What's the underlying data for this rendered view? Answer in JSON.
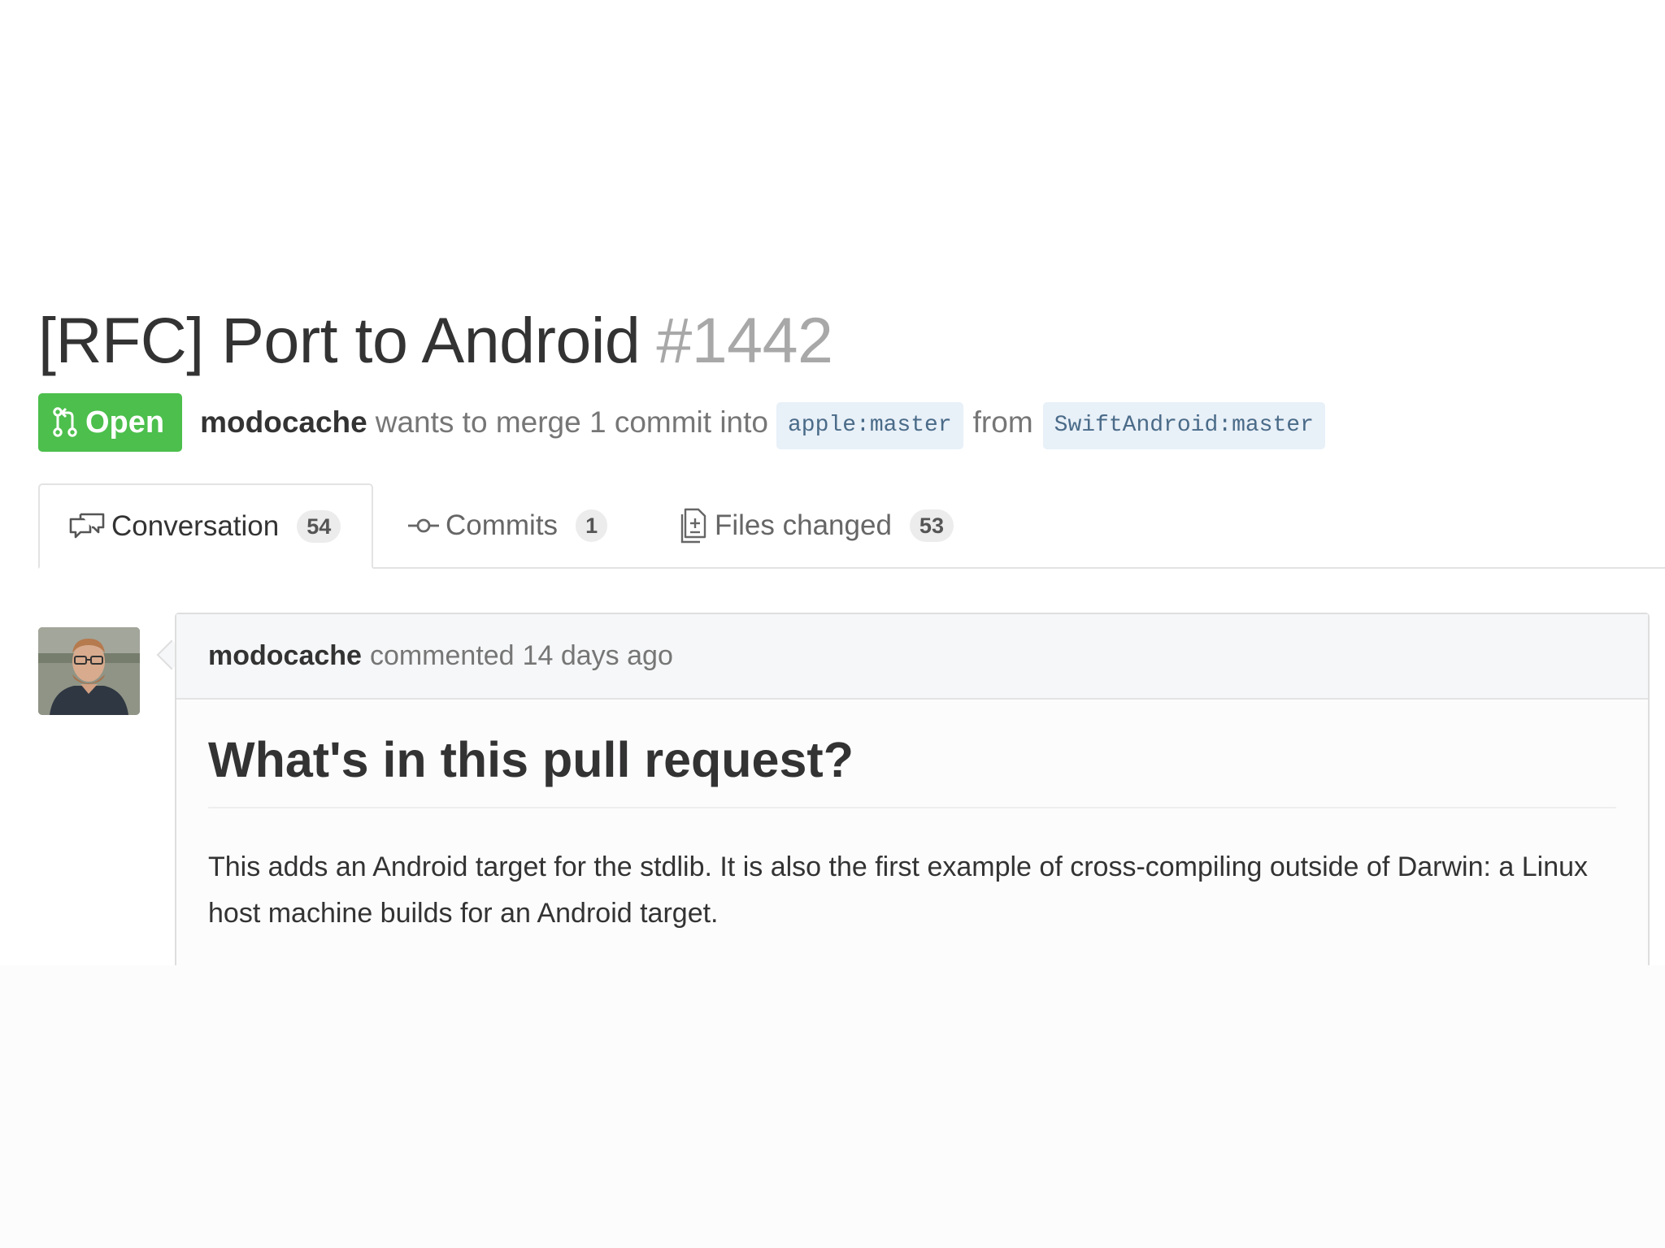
{
  "title": {
    "text": "[RFC] Port to Android",
    "number": "#1442"
  },
  "state": {
    "label": "Open",
    "icon": "git-pull-request-icon",
    "color": "#4cbf4c"
  },
  "meta": {
    "author": "modocache",
    "action": "wants to merge 1 commit into",
    "base_branch": "apple:master",
    "from_word": "from",
    "head_branch": "SwiftAndroid:master"
  },
  "tabs": [
    {
      "label": "Conversation",
      "count": "54",
      "icon": "comment-discussion-icon",
      "selected": true
    },
    {
      "label": "Commits",
      "count": "1",
      "icon": "git-commit-icon",
      "selected": false
    },
    {
      "label": "Files changed",
      "count": "53",
      "icon": "file-diff-icon",
      "selected": false
    }
  ],
  "comment": {
    "author": "modocache",
    "action": "commented",
    "time": "14 days ago",
    "heading": "What's in this pull request?",
    "body": "This adds an Android target for the stdlib. It is also the first example of cross-compiling outside of Darwin: a Linux host machine builds for an Android target."
  }
}
